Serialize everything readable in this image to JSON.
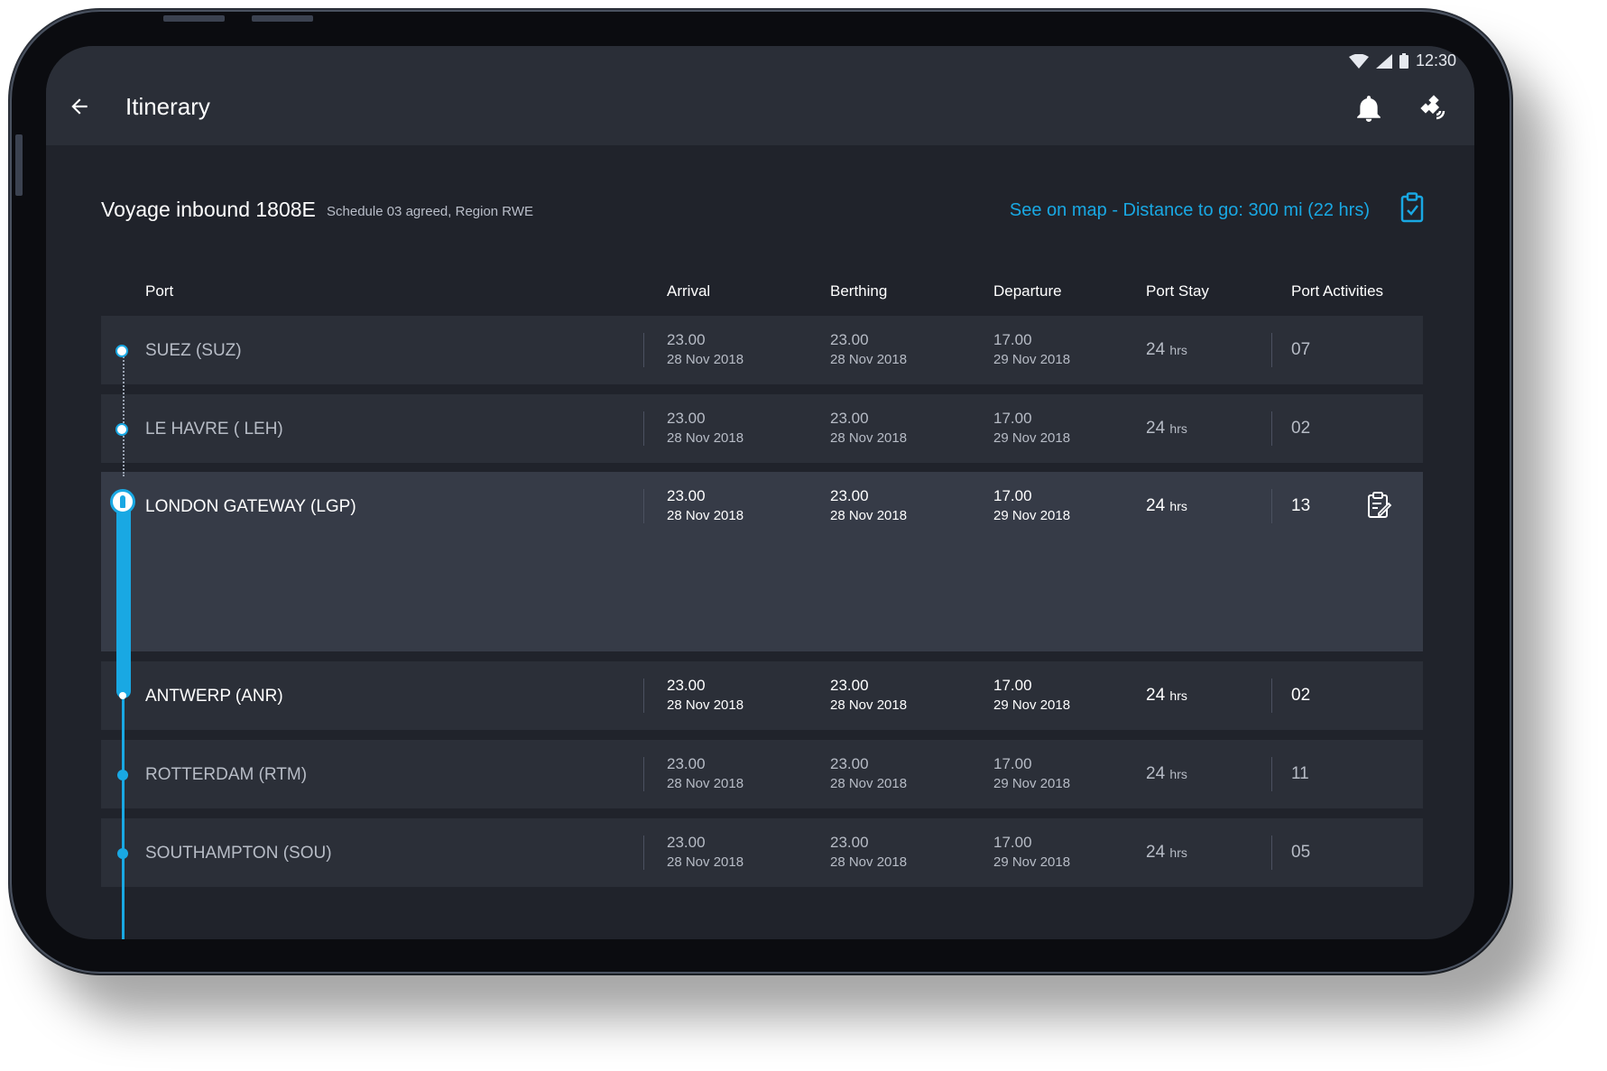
{
  "status_bar": {
    "time": "12:30"
  },
  "app_bar": {
    "title": "Itinerary"
  },
  "voyage": {
    "title": "Voyage inbound 1808E",
    "schedule": "Schedule 03 agreed, Region RWE",
    "map_link": "See on map - Distance to go: 300 mi (22 hrs)"
  },
  "table": {
    "headers": {
      "port": "Port",
      "arrival": "Arrival",
      "berthing": "Berthing",
      "departure": "Departure",
      "port_stay": "Port Stay",
      "port_activities": "Port Activities"
    },
    "rows": [
      {
        "port": "SUEZ (SUZ)",
        "arrival_time": "23.00",
        "arrival_date": "28 Nov 2018",
        "berthing_time": "23.00",
        "berthing_date": "28 Nov 2018",
        "departure_time": "17.00",
        "departure_date": "29 Nov 2018",
        "stay_value": "24",
        "stay_unit": "hrs",
        "activities": "07"
      },
      {
        "port": "LE HAVRE ( LEH)",
        "arrival_time": "23.00",
        "arrival_date": "28 Nov 2018",
        "berthing_time": "23.00",
        "berthing_date": "28 Nov 2018",
        "departure_time": "17.00",
        "departure_date": "29 Nov 2018",
        "stay_value": "24",
        "stay_unit": "hrs",
        "activities": "02"
      },
      {
        "port": "LONDON GATEWAY (LGP)",
        "arrival_time": "23.00",
        "arrival_date": "28 Nov 2018",
        "berthing_time": "23.00",
        "berthing_date": "28 Nov 2018",
        "departure_time": "17.00",
        "departure_date": "29 Nov 2018",
        "stay_value": "24",
        "stay_unit": "hrs",
        "activities": "13"
      },
      {
        "port": "ANTWERP (ANR)",
        "arrival_time": "23.00",
        "arrival_date": "28 Nov 2018",
        "berthing_time": "23.00",
        "berthing_date": "28 Nov 2018",
        "departure_time": "17.00",
        "departure_date": "29 Nov 2018",
        "stay_value": "24",
        "stay_unit": "hrs",
        "activities": "02"
      },
      {
        "port": "ROTTERDAM (RTM)",
        "arrival_time": "23.00",
        "arrival_date": "28 Nov 2018",
        "berthing_time": "23.00",
        "berthing_date": "28 Nov 2018",
        "departure_time": "17.00",
        "departure_date": "29 Nov 2018",
        "stay_value": "24",
        "stay_unit": "hrs",
        "activities": "11"
      },
      {
        "port": "SOUTHAMPTON (SOU)",
        "arrival_time": "23.00",
        "arrival_date": "28 Nov 2018",
        "berthing_time": "23.00",
        "berthing_date": "28 Nov 2018",
        "departure_time": "17.00",
        "departure_date": "29 Nov 2018",
        "stay_value": "24",
        "stay_unit": "hrs",
        "activities": "05"
      }
    ]
  },
  "icons": {
    "back": "arrow-left-icon",
    "bell": "bell-icon",
    "satellite": "satellite-icon",
    "clipboard": "clipboard-check-icon",
    "activities": "clipboard-edit-icon"
  },
  "colors": {
    "accent": "#19a8e3",
    "background": "#20232b",
    "row": "#2b2f38",
    "row_expanded": "#363b47"
  }
}
